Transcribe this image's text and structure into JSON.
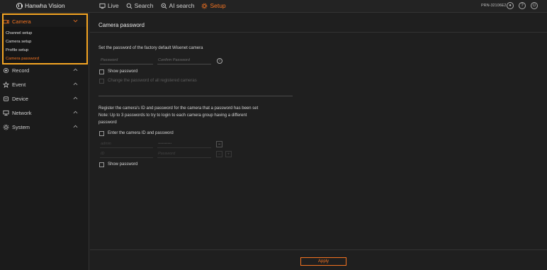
{
  "topbar": {
    "brand": "Hanwha Vision",
    "nav": [
      {
        "label": "Live",
        "icon": "monitor-icon"
      },
      {
        "label": "Search",
        "icon": "search-icon"
      },
      {
        "label": "AI search",
        "icon": "ai-search-icon"
      },
      {
        "label": "Setup",
        "icon": "gear-icon",
        "active": true
      }
    ],
    "model": "PRN-32106E2",
    "icons": [
      "user-icon",
      "help-icon",
      "power-icon"
    ]
  },
  "sidebar": {
    "camera_label": "Camera",
    "camera_subitems": [
      "Channel setup",
      "Camera setup",
      "Profile setup",
      "Camera password"
    ],
    "groups": [
      "Record",
      "Event",
      "Device",
      "Network",
      "System"
    ]
  },
  "main": {
    "title": "Camera password",
    "section1": {
      "heading": "Set the password of the factory default Wisenet camera",
      "password_placeholder": "Password",
      "confirm_placeholder": "Confirm Password",
      "show_password": "Show password",
      "change_all": "Change the password of all registered cameras"
    },
    "section2": {
      "line1": "Register the camera's ID and password for the camera that a password has been set",
      "line2": "Note: Up to 3 passwords to try to login to each camera group having a different",
      "line3": "password",
      "enter_label": "Enter the camera ID and password",
      "row1_id": "admin",
      "row1_pw": "••••••••••",
      "row2_id": "ID",
      "row2_pw": "Password",
      "show_password": "Show password"
    },
    "apply_label": "Apply"
  },
  "colors": {
    "accent": "#f37321",
    "highlight_box": "#f5a623",
    "background": "#1f1f1f"
  }
}
